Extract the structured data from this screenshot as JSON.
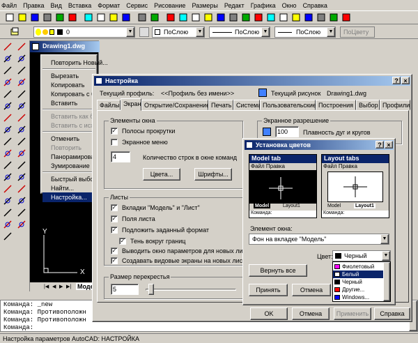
{
  "menubar": [
    "Файл",
    "Правка",
    "Вид",
    "Вставка",
    "Формат",
    "Сервис",
    "Рисование",
    "Размеры",
    "Редакт",
    "Графика",
    "Окно",
    "Справка"
  ],
  "layer_toolbar": {
    "layer_value": "0",
    "linetype_value": "ПоСлою",
    "line_value": "ПоСлою",
    "lineweight_value": "ПоСлою",
    "plotstyle_value": "ПоЦвету"
  },
  "drawing": {
    "title": "Drawing1.dwg",
    "model_tab": "Модел",
    "axis_x": "X",
    "axis_y": "Y"
  },
  "context_menu": {
    "items": [
      {
        "label": "Повторить Новый...",
        "disabled": false
      },
      {
        "label": "Вырезать",
        "disabled": false
      },
      {
        "label": "Копировать",
        "disabled": false
      },
      {
        "label": "Копировать с ба",
        "disabled": false
      },
      {
        "label": "Вставить",
        "disabled": false
      },
      {
        "label": "Вставить как бл",
        "disabled": true
      },
      {
        "label": "Вставить с исхо",
        "disabled": true
      },
      {
        "label": "Отменить",
        "disabled": false
      },
      {
        "label": "Повторить",
        "disabled": true
      },
      {
        "label": "Панорамировани",
        "disabled": false
      },
      {
        "label": "Зумирование",
        "disabled": false
      },
      {
        "label": "Быстрый выбор...",
        "disabled": false
      },
      {
        "label": "Найти...",
        "disabled": false
      },
      {
        "label": "Настройка...",
        "disabled": false
      }
    ]
  },
  "options_dialog": {
    "title": "Настройка",
    "profile_label": "Текущий профиль:",
    "profile_value": "<<Профиль без имени>>",
    "drawing_label": "Текущий рисунок",
    "drawing_value": "Drawing1.dwg",
    "tabs": [
      "Файлы",
      "Экран",
      "Открытие/Сохранение",
      "Печать",
      "Система",
      "Пользовательские",
      "Построения",
      "Выбор",
      "Профили"
    ],
    "window_elements_title": "Элементы окна",
    "scrollbars_label": "Полосы прокрутки",
    "screen_menu_label": "Экранное меню",
    "cmd_lines_value": "4",
    "cmd_lines_label": "Количество строк в окне команд",
    "colors_button": "Цвета...",
    "fonts_button": "Шрифты...",
    "layouts_title": "Листы",
    "layout_model_tabs": "Вкладки \"Модель\" и \"Лист\"",
    "layout_margins": "Поля листа",
    "layout_paper_bg": "Подложить заданный формат",
    "layout_shadow": "Тень вокруг границ",
    "layout_page_setup": "Выводить окно параметров для новых листов",
    "layout_viewports": "Создавать видовые экраны на новых листах",
    "crosshair_title": "Размер перекрестья",
    "crosshair_value": "5",
    "resolution_title": "Экранное разрешение",
    "arc_value": "100",
    "arc_label": "Плавность дуг и кругов",
    "ok": "OK",
    "cancel": "Отмена",
    "apply": "Применить",
    "help": "Справка"
  },
  "color_dialog": {
    "title": "Установка цветов",
    "model_tab_title": "Model tab",
    "layout_tabs_title": "Layout tabs",
    "mini_menu": "Файл Правка",
    "preview_cmd": "Команда:",
    "preview_model": "Model",
    "preview_layout": "Layout1",
    "element_label": "Элемент окна:",
    "element_value": "Фон на вкладке \"Модель\"",
    "color_label": "Цвет:",
    "color_value": "Черный",
    "restore_button": "Вернуть все",
    "accept_button": "Принять",
    "cancel_button": "Отмена",
    "color_options": [
      {
        "label": "Фиолетовый",
        "swatch": "#ff00ff",
        "selected": false
      },
      {
        "label": "Белый",
        "swatch": "#ffffff",
        "selected": true
      },
      {
        "label": "Черный",
        "swatch": "#000000",
        "selected": false
      },
      {
        "label": "Другие...",
        "swatch": "#ff0000",
        "selected": false
      },
      {
        "label": "Windows...",
        "swatch": "#0000ff",
        "selected": false
      }
    ]
  },
  "command_lines": [
    "Команда: _new",
    "Команда: Противоположн",
    "Команда: Противоположн",
    "Команда:"
  ],
  "status_text": "Настройка параметров AutoCAD: НАСТРОЙКА"
}
